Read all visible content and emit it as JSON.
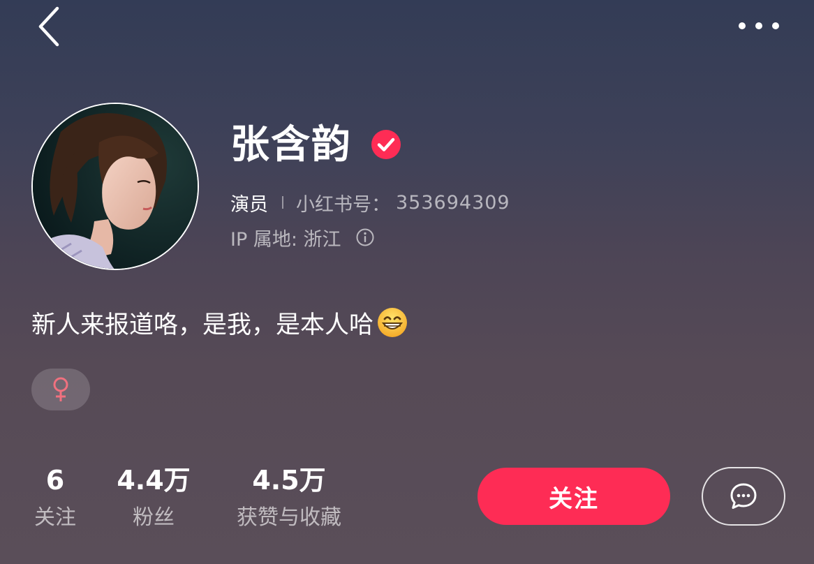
{
  "nav": {
    "back_icon": "chevron-left-icon",
    "more_icon": "more-dots-icon"
  },
  "profile": {
    "name": "张含韵",
    "verified_icon": "verified-check-icon",
    "role": "演员",
    "id_label": "小红书号：",
    "id_value": "353694309",
    "ip_location": "IP 属地: 浙江",
    "info_icon": "info-icon",
    "bio": "新人来报道咯，是我，是本人哈",
    "bio_emoji": "grinning-face-emoji",
    "gender_icon": "female-icon"
  },
  "stats": [
    {
      "value": "6",
      "label": "关注"
    },
    {
      "value": "4.4万",
      "label": "粉丝"
    },
    {
      "value": "4.5万",
      "label": "获赞与收藏"
    }
  ],
  "actions": {
    "follow_label": "关注",
    "message_icon": "chat-bubble-icon"
  },
  "colors": {
    "accent": "#fe2c55",
    "gender_icon": "#f0717f",
    "background_top": "#333c56",
    "background_bottom": "#5a4e59"
  }
}
